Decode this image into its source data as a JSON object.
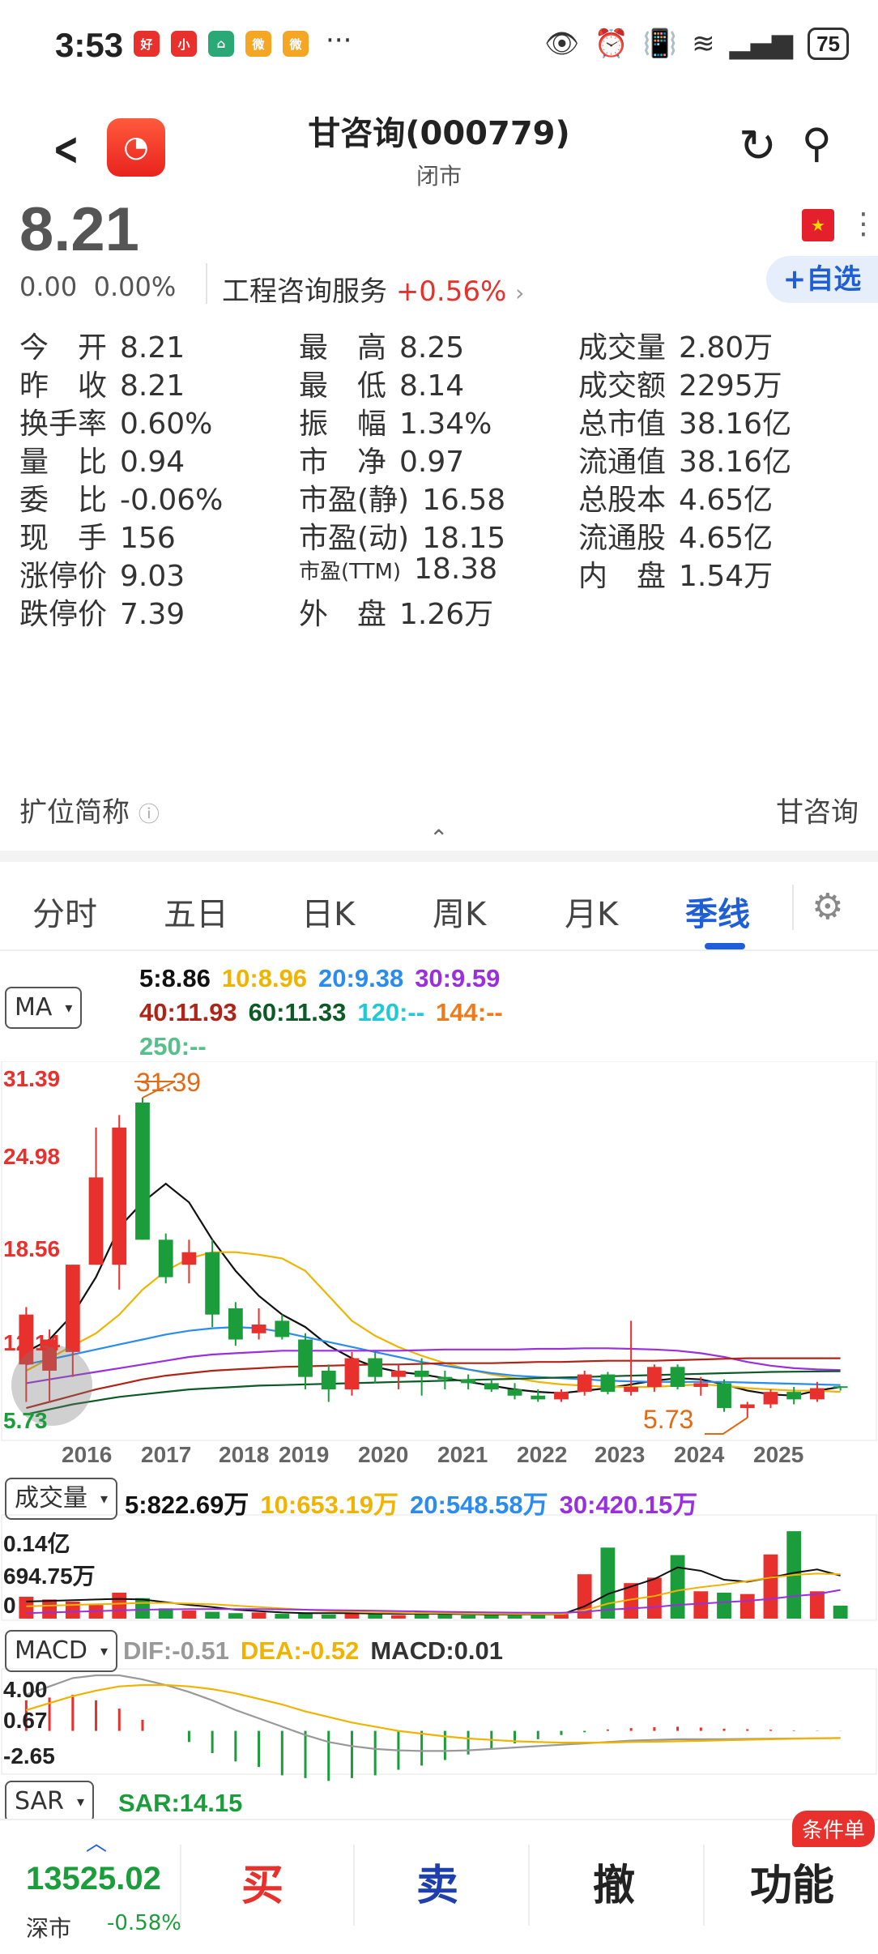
{
  "status_bar": {
    "time": "3:53",
    "dots": "···",
    "battery": "75",
    "app_icons": [
      {
        "name": "mall-app-icon",
        "color": "#e8302c",
        "glyph": "好"
      },
      {
        "name": "xiaohongshu-icon",
        "color": "#e8302c",
        "glyph": "小"
      },
      {
        "name": "home-app-icon",
        "color": "#2aa876",
        "glyph": "⌂"
      },
      {
        "name": "weibo-icon",
        "color": "#f5a623",
        "glyph": "微"
      },
      {
        "name": "weibo-icon-2",
        "color": "#f5a623",
        "glyph": "微"
      }
    ]
  },
  "header": {
    "title": "甘咨询(000779)",
    "subtitle": "闭市"
  },
  "quote": {
    "price": "8.21",
    "change": "0.00",
    "change_pct": "0.00%",
    "industry": "工程咨询服务",
    "industry_pct": "+0.56%",
    "watch_label": "+自选"
  },
  "stats": [
    {
      "label": "今　开",
      "value": "8.21"
    },
    {
      "label": "最　高",
      "value": "8.25"
    },
    {
      "label": "成交量",
      "value": "2.80万"
    },
    {
      "label": "昨　收",
      "value": "8.21"
    },
    {
      "label": "最　低",
      "value": "8.14"
    },
    {
      "label": "成交额",
      "value": "2295万"
    },
    {
      "label": "换手率",
      "value": "0.60%"
    },
    {
      "label": "振　幅",
      "value": "1.34%"
    },
    {
      "label": "总市值",
      "value": "38.16亿"
    },
    {
      "label": "量　比",
      "value": "0.94"
    },
    {
      "label": "市　净",
      "value": "0.97"
    },
    {
      "label": "流通值",
      "value": "38.16亿"
    },
    {
      "label": "委　比",
      "value": "-0.06%"
    },
    {
      "label": "市盈(静)",
      "value": "16.58"
    },
    {
      "label": "总股本",
      "value": "4.65亿"
    },
    {
      "label": "现　手",
      "value": "156"
    },
    {
      "label": "市盈(动)",
      "value": "18.15"
    },
    {
      "label": "流通股",
      "value": "4.65亿"
    },
    {
      "label": "涨停价",
      "value": "9.03"
    },
    {
      "label": "市盈(TTM)",
      "value": "18.38"
    },
    {
      "label": "内　盘",
      "value": "1.54万"
    },
    {
      "label": "跌停价",
      "value": "7.39"
    },
    {
      "label": "外　盘",
      "value": "1.26万"
    }
  ],
  "extended_name": {
    "label": "扩位简称",
    "value": "甘咨询"
  },
  "tabs": [
    "分时",
    "五日",
    "日K",
    "周K",
    "月K",
    "季线"
  ],
  "active_tab": "季线",
  "ma": {
    "selector": "MA",
    "items": [
      {
        "text": "5:8.86",
        "color": "#111111"
      },
      {
        "text": "10:8.96",
        "color": "#f0b400"
      },
      {
        "text": "20:9.38",
        "color": "#2a8bf0"
      },
      {
        "text": "30:9.59",
        "color": "#9a2fe0"
      },
      {
        "text": "40:11.93",
        "color": "#b02418"
      },
      {
        "text": "60:11.33",
        "color": "#0c5a25"
      },
      {
        "text": "120:--",
        "color": "#1ec9d8"
      },
      {
        "text": "144:--",
        "color": "#f07a1a"
      },
      {
        "text": "250:--",
        "color": "#57c08a"
      }
    ]
  },
  "kline_axis": {
    "top": "31.39",
    "mid1": "24.98",
    "mid2": "18.56",
    "low1": "12.14",
    "bottom": "5.73",
    "max_marker": "31.39",
    "min_marker": "5.73",
    "years": [
      "2016",
      "2017",
      "2018",
      "2019",
      "2020",
      "2021",
      "2022",
      "2023",
      "2024",
      "2025"
    ]
  },
  "volume": {
    "selector": "成交量",
    "items": [
      {
        "text": "5:822.69万",
        "color": "#111111"
      },
      {
        "text": "10:653.19万",
        "color": "#f0b400"
      },
      {
        "text": "20:548.58万",
        "color": "#2a8bf0"
      },
      {
        "text": "30:420.15万",
        "color": "#9a2fe0"
      }
    ],
    "axis_top": "0.14亿",
    "axis_mid": "694.75万",
    "axis_zero": "0"
  },
  "macd": {
    "selector": "MACD",
    "items": [
      {
        "text": "DIF:-0.51",
        "color": "#999999"
      },
      {
        "text": "DEA:-0.52",
        "color": "#f0b400"
      },
      {
        "text": "MACD:0.01",
        "color": "#333333"
      }
    ],
    "axis_top": "4.00",
    "axis_mid": "0.67",
    "axis_bottom": "-2.65"
  },
  "sar": {
    "selector": "SAR",
    "value": "SAR:14.15"
  },
  "chart_data": {
    "type": "candlestick",
    "ylim": [
      5.73,
      31.39
    ],
    "candles": [
      {
        "o": 10.0,
        "h": 14.6,
        "l": 7.0,
        "c": 14.0
      },
      {
        "o": 9.5,
        "h": 12.8,
        "l": 7.0,
        "c": 12.0
      },
      {
        "o": 11.0,
        "h": 18.0,
        "l": 9.0,
        "c": 18.0
      },
      {
        "o": 18.0,
        "h": 29.0,
        "l": 18.0,
        "c": 25.0
      },
      {
        "o": 18.0,
        "h": 30.0,
        "l": 16.0,
        "c": 29.0
      },
      {
        "o": 31.0,
        "h": 31.39,
        "l": 20.0,
        "c": 20.0
      },
      {
        "o": 20.0,
        "h": 20.5,
        "l": 16.5,
        "c": 17.0
      },
      {
        "o": 18.0,
        "h": 20.0,
        "l": 16.5,
        "c": 19.0
      },
      {
        "o": 19.0,
        "h": 20.0,
        "l": 13.0,
        "c": 14.0
      },
      {
        "o": 14.5,
        "h": 15.0,
        "l": 11.5,
        "c": 12.0
      },
      {
        "o": 12.5,
        "h": 14.5,
        "l": 12.0,
        "c": 13.2
      },
      {
        "o": 13.5,
        "h": 14.0,
        "l": 12.0,
        "c": 12.2
      },
      {
        "o": 12.0,
        "h": 12.5,
        "l": 8.0,
        "c": 9.0
      },
      {
        "o": 9.5,
        "h": 10.0,
        "l": 7.0,
        "c": 8.0
      },
      {
        "o": 8.0,
        "h": 11.0,
        "l": 7.5,
        "c": 10.5
      },
      {
        "o": 10.5,
        "h": 11.0,
        "l": 8.5,
        "c": 9.0
      },
      {
        "o": 9.0,
        "h": 10.0,
        "l": 8.0,
        "c": 9.5
      },
      {
        "o": 9.5,
        "h": 10.5,
        "l": 7.5,
        "c": 9.0
      },
      {
        "o": 9.0,
        "h": 9.5,
        "l": 8.0,
        "c": 8.8
      },
      {
        "o": 8.8,
        "h": 9.2,
        "l": 8.0,
        "c": 8.5
      },
      {
        "o": 8.5,
        "h": 8.8,
        "l": 7.8,
        "c": 8.0
      },
      {
        "o": 8.0,
        "h": 8.5,
        "l": 7.2,
        "c": 7.5
      },
      {
        "o": 7.5,
        "h": 8.0,
        "l": 7.0,
        "c": 7.2
      },
      {
        "o": 7.2,
        "h": 8.0,
        "l": 7.0,
        "c": 7.8
      },
      {
        "o": 7.8,
        "h": 9.5,
        "l": 7.5,
        "c": 9.2
      },
      {
        "o": 9.2,
        "h": 9.4,
        "l": 7.6,
        "c": 7.8
      },
      {
        "o": 7.8,
        "h": 13.5,
        "l": 7.5,
        "c": 8.2
      },
      {
        "o": 8.2,
        "h": 10.0,
        "l": 7.8,
        "c": 9.8
      },
      {
        "o": 9.8,
        "h": 10.0,
        "l": 8.0,
        "c": 8.2
      },
      {
        "o": 8.2,
        "h": 9.0,
        "l": 7.5,
        "c": 8.5
      },
      {
        "o": 8.5,
        "h": 8.8,
        "l": 6.2,
        "c": 6.5
      },
      {
        "o": 6.5,
        "h": 7.0,
        "l": 5.73,
        "c": 6.8
      },
      {
        "o": 6.8,
        "h": 8.0,
        "l": 6.5,
        "c": 7.8
      },
      {
        "o": 7.8,
        "h": 8.2,
        "l": 6.8,
        "c": 7.2
      },
      {
        "o": 7.2,
        "h": 8.6,
        "l": 7.0,
        "c": 8.1
      },
      {
        "o": 8.25,
        "h": 8.25,
        "l": 7.9,
        "c": 8.21
      }
    ],
    "ma5": [
      11,
      12,
      14,
      17,
      21,
      23,
      24.5,
      23,
      20,
      17.5,
      15.5,
      14,
      13,
      11.5,
      10.5,
      9.8,
      9.4,
      9.2,
      8.9,
      8.6,
      8.3,
      8.0,
      7.8,
      7.7,
      7.9,
      8.1,
      8.4,
      8.7,
      8.9,
      8.8,
      8.4,
      7.9,
      7.6,
      7.5,
      7.9,
      8.2
    ],
    "ma10": [
      9.5,
      10.5,
      11.5,
      12.5,
      14,
      16,
      17.5,
      18.5,
      19,
      19,
      18.8,
      18.5,
      17.5,
      15.5,
      13.5,
      12.3,
      11.4,
      10.7,
      10.1,
      9.6,
      9.2,
      8.9,
      8.6,
      8.4,
      8.3,
      8.2,
      8.2,
      8.2,
      8.3,
      8.4,
      8.3,
      8.1,
      8.0,
      7.9,
      7.9,
      7.8
    ],
    "ma20": [
      10,
      10.4,
      10.8,
      11.2,
      11.6,
      12.0,
      12.4,
      12.7,
      12.9,
      13.0,
      12.9,
      12.6,
      12.2,
      11.8,
      11.4,
      11.0,
      10.6,
      10.2,
      9.9,
      9.6,
      9.3,
      9.1,
      9.0,
      8.9,
      8.8,
      8.7,
      8.65,
      8.6,
      8.6,
      8.6,
      8.6,
      8.55,
      8.5,
      8.45,
      8.4,
      8.35
    ],
    "ma30": [
      8.5,
      8.8,
      9.1,
      9.4,
      9.7,
      10.0,
      10.3,
      10.6,
      10.8,
      10.9,
      11.0,
      11.1,
      11.1,
      11.1,
      11.1,
      11.1,
      11.1,
      11.15,
      11.2,
      11.2,
      11.2,
      11.2,
      11.25,
      11.25,
      11.3,
      11.3,
      11.25,
      11.2,
      11.1,
      10.9,
      10.6,
      10.2,
      9.9,
      9.7,
      9.6,
      9.55
    ],
    "ma40": [
      6.5,
      7.0,
      7.5,
      8.0,
      8.4,
      8.8,
      9.1,
      9.3,
      9.5,
      9.6,
      9.7,
      9.8,
      9.85,
      9.9,
      9.95,
      10.0,
      10.0,
      10.05,
      10.1,
      10.1,
      10.1,
      10.15,
      10.2,
      10.2,
      10.25,
      10.3,
      10.3,
      10.3,
      10.35,
      10.4,
      10.45,
      10.5,
      10.5,
      10.5,
      10.5,
      10.5
    ],
    "ma60": [
      6.0,
      6.4,
      6.8,
      7.1,
      7.4,
      7.6,
      7.8,
      8.0,
      8.1,
      8.2,
      8.3,
      8.35,
      8.4,
      8.45,
      8.5,
      8.55,
      8.6,
      8.65,
      8.7,
      8.75,
      8.8,
      8.85,
      8.9,
      8.95,
      9.0,
      9.05,
      9.1,
      9.15,
      9.2,
      9.25,
      9.3,
      9.35,
      9.4,
      9.42,
      9.44,
      9.46
    ],
    "volume_ylim": [
      0,
      14000000
    ],
    "volumes": [
      3.2,
      2.8,
      2.5,
      2.0,
      3.8,
      3.0,
      1.5,
      1.2,
      1.0,
      0.8,
      0.9,
      0.7,
      0.9,
      0.6,
      0.8,
      0.7,
      0.5,
      1.0,
      0.7,
      0.5,
      0.6,
      0.5,
      0.6,
      0.7,
      6.5,
      10.4,
      5.2,
      6.0,
      9.3,
      4.0,
      3.8,
      3.6,
      9.4,
      12.8,
      4.0,
      1.9
    ],
    "volume_ma5": [
      2.5,
      2.6,
      2.7,
      2.8,
      2.9,
      2.8,
      2.4,
      2.0,
      1.7,
      1.3,
      1.1,
      0.9,
      0.8,
      0.8,
      0.8,
      0.75,
      0.7,
      0.7,
      0.7,
      0.65,
      0.6,
      0.6,
      0.6,
      0.6,
      1.8,
      3.6,
      4.7,
      5.8,
      7.5,
      7.0,
      5.7,
      5.4,
      6.0,
      6.7,
      7.2,
      6.3
    ],
    "volume_ma10": [
      1.8,
      1.9,
      2.0,
      2.1,
      2.2,
      2.3,
      2.3,
      2.2,
      2.1,
      1.9,
      1.7,
      1.5,
      1.3,
      1.1,
      1.0,
      0.9,
      0.85,
      0.8,
      0.8,
      0.75,
      0.7,
      0.68,
      0.65,
      0.65,
      1.2,
      2.2,
      2.8,
      3.3,
      4.1,
      4.6,
      5.0,
      5.5,
      6.0,
      6.4,
      6.6,
      6.5
    ],
    "volume_ma30": [
      0.8,
      0.9,
      1.0,
      1.1,
      1.2,
      1.3,
      1.35,
      1.4,
      1.4,
      1.4,
      1.4,
      1.35,
      1.3,
      1.25,
      1.2,
      1.15,
      1.1,
      1.05,
      1.0,
      0.95,
      0.9,
      0.88,
      0.86,
      0.85,
      1.0,
      1.3,
      1.5,
      1.7,
      2.0,
      2.2,
      2.4,
      2.6,
      2.9,
      3.3,
      3.6,
      4.2
    ],
    "macd_ylim": [
      -2.65,
      4.0
    ],
    "dif": [
      2.6,
      3.2,
      3.8,
      4.0,
      4.0,
      3.7,
      3.3,
      2.8,
      2.2,
      1.5,
      0.9,
      0.3,
      -0.3,
      -0.8,
      -1.1,
      -1.3,
      -1.4,
      -1.45,
      -1.45,
      -1.4,
      -1.3,
      -1.2,
      -1.1,
      -1.0,
      -0.9,
      -0.8,
      -0.7,
      -0.65,
      -0.6,
      -0.6,
      -0.6,
      -0.58,
      -0.56,
      -0.55,
      -0.53,
      -0.51
    ],
    "dea": [
      1.5,
      2.0,
      2.5,
      2.9,
      3.2,
      3.3,
      3.3,
      3.2,
      3.0,
      2.7,
      2.3,
      1.9,
      1.4,
      1.0,
      0.6,
      0.3,
      0.0,
      -0.2,
      -0.4,
      -0.55,
      -0.65,
      -0.75,
      -0.8,
      -0.85,
      -0.85,
      -0.85,
      -0.8,
      -0.78,
      -0.75,
      -0.72,
      -0.68,
      -0.64,
      -0.6,
      -0.57,
      -0.54,
      -0.52
    ],
    "macd_hist": [
      2.2,
      2.4,
      2.6,
      2.2,
      1.6,
      0.8,
      0.0,
      -0.8,
      -1.6,
      -2.2,
      -2.6,
      -3.2,
      -3.4,
      -3.6,
      -3.4,
      -3.2,
      -2.8,
      -2.5,
      -2.1,
      -1.7,
      -1.3,
      -0.9,
      -0.6,
      -0.3,
      -0.1,
      0.1,
      0.2,
      0.26,
      0.3,
      0.24,
      0.16,
      0.12,
      0.08,
      0.04,
      0.02,
      0.01
    ]
  },
  "bottom_bar": {
    "index_value": "13525.02",
    "index_name": "深市",
    "index_pct": "-0.58%",
    "buy": "买",
    "sell": "卖",
    "cancel": "撤",
    "func": "功能",
    "badge": "条件单",
    "colors": {
      "up": "#e8302c",
      "down": "#1a9d3a",
      "sell": "#1e3fb0",
      "accent": "#1e5fd8"
    }
  }
}
